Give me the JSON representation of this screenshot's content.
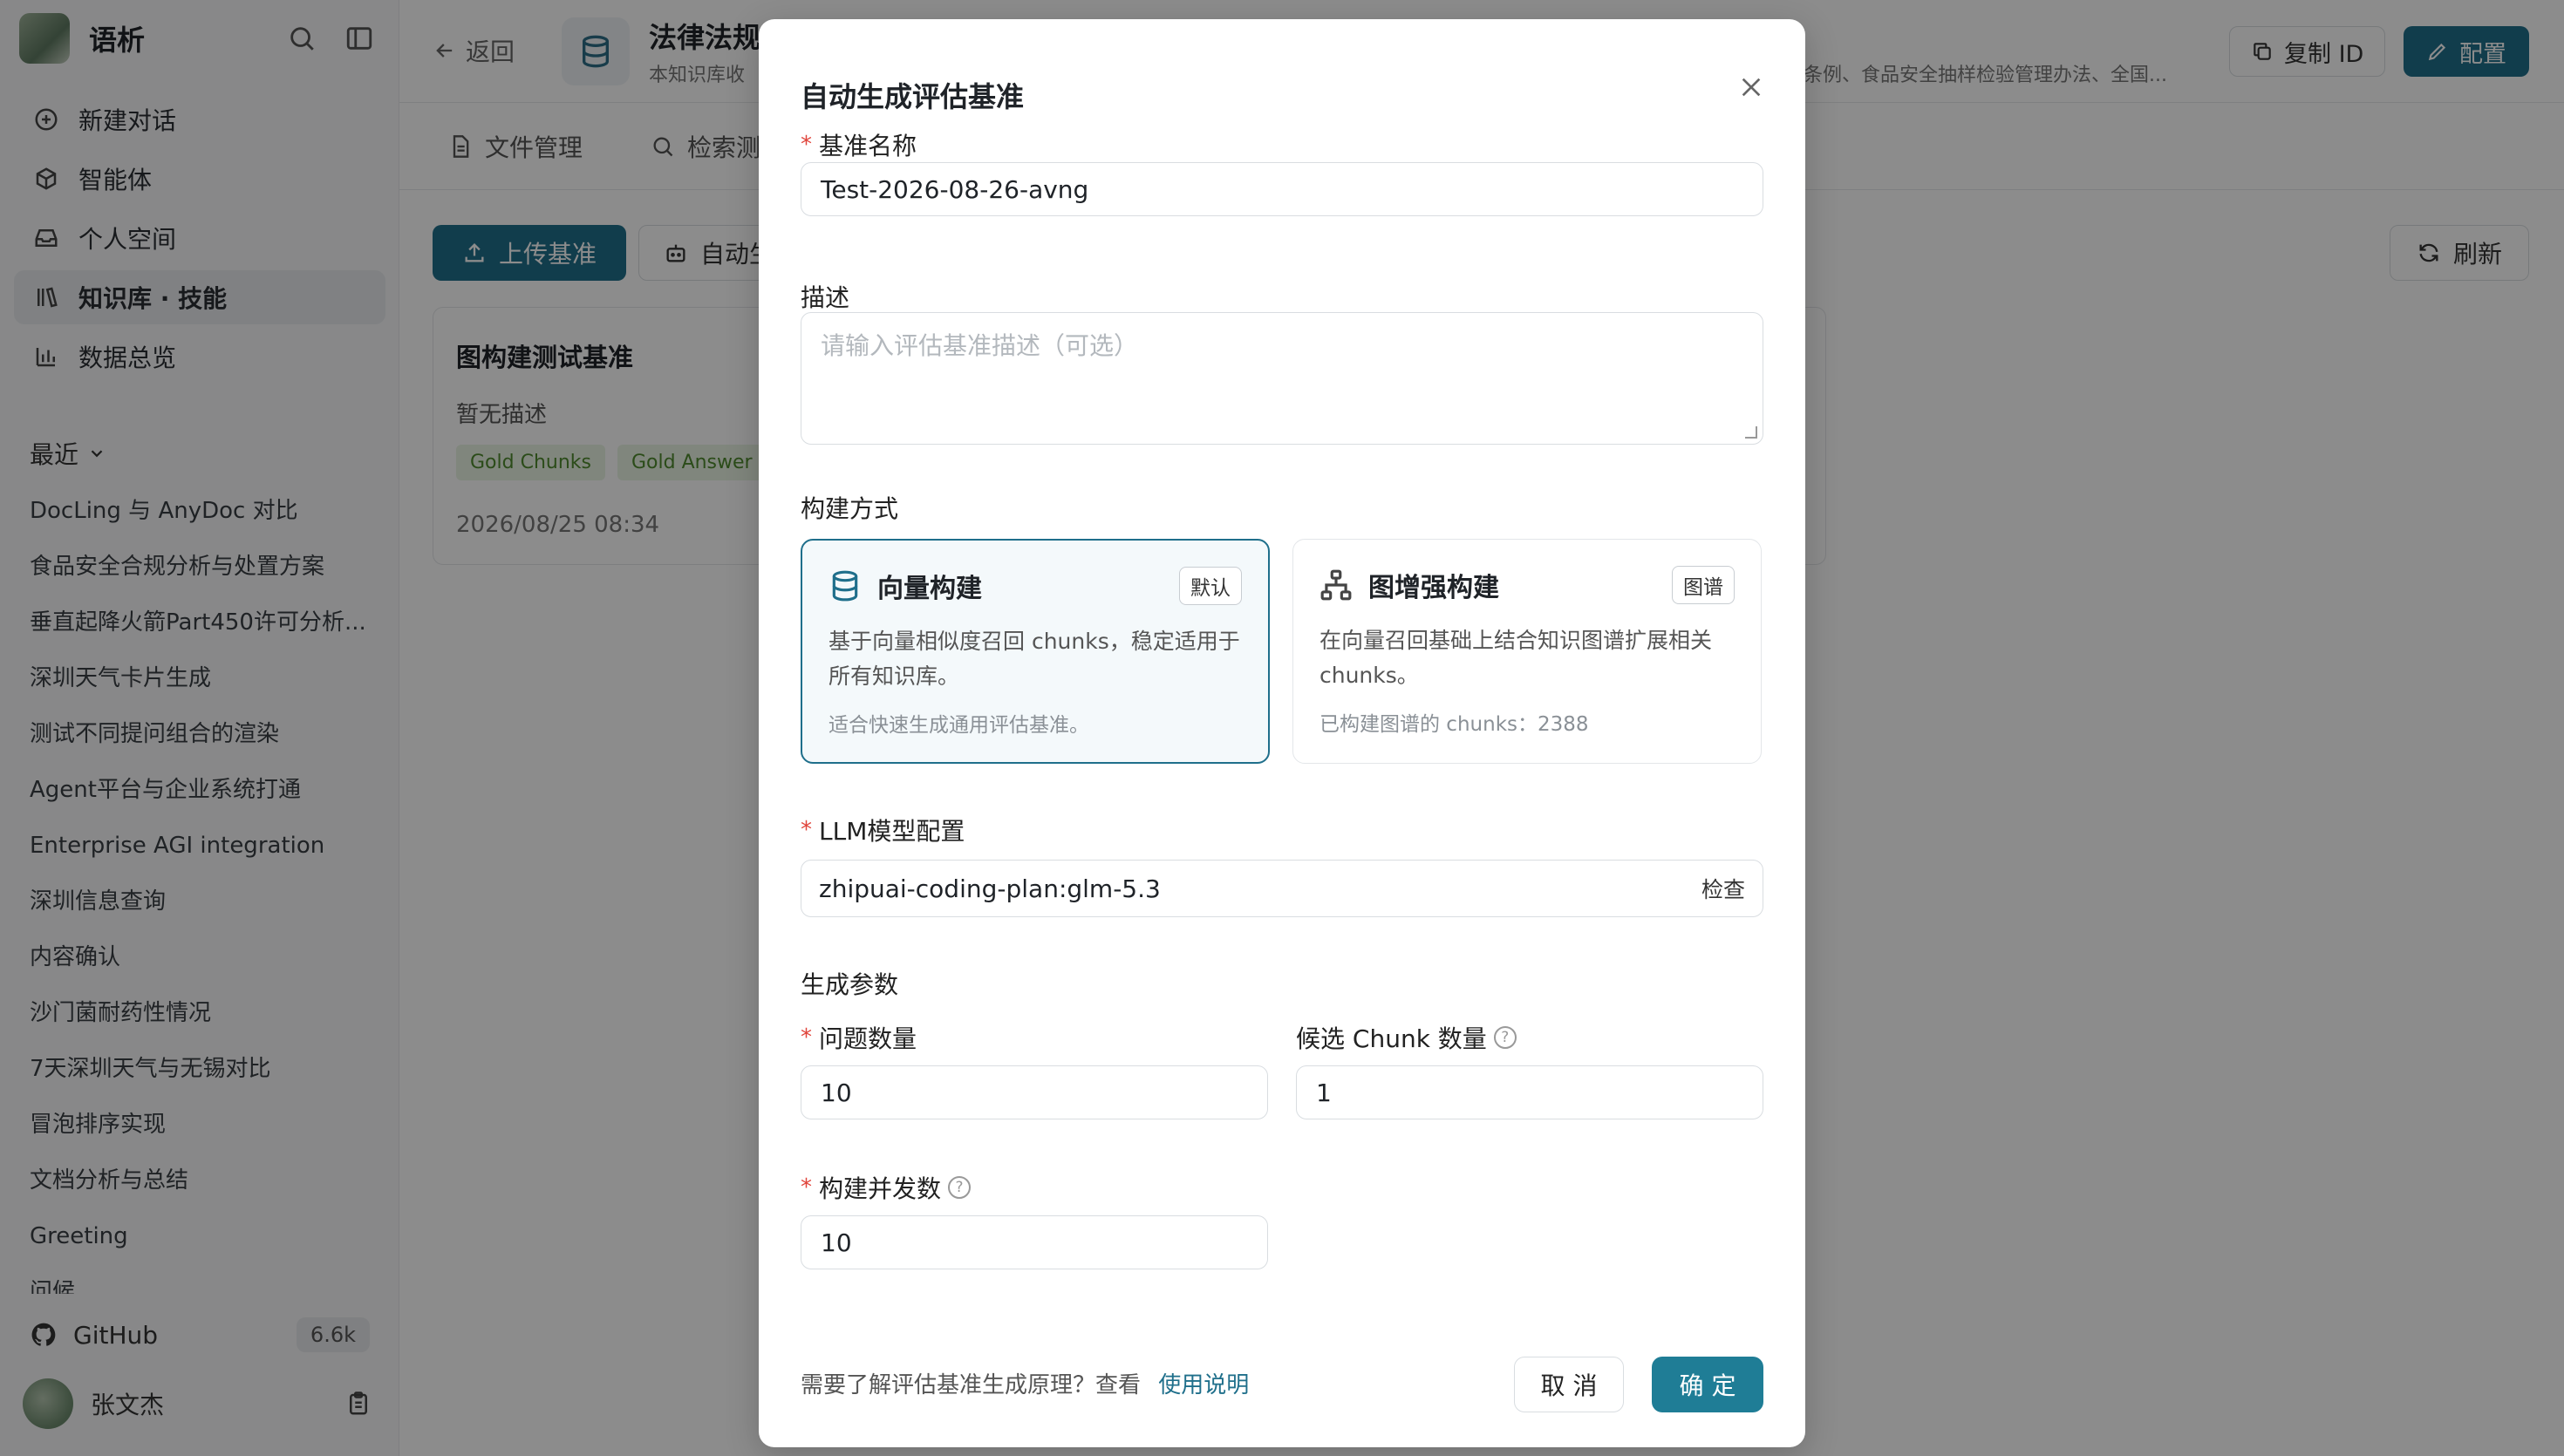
{
  "app": {
    "name": "语析"
  },
  "sidebar": {
    "nav": [
      {
        "label": "新建对话",
        "icon": "plus-circle-icon"
      },
      {
        "label": "智能体",
        "icon": "cube-icon"
      },
      {
        "label": "个人空间",
        "icon": "inbox-icon"
      },
      {
        "label": "知识库 · 技能",
        "icon": "library-icon",
        "active": true
      },
      {
        "label": "数据总览",
        "icon": "bar-chart-icon"
      }
    ],
    "recent_label": "最近",
    "recent": [
      "DocLing 与 AnyDoc 对比",
      "食品安全合规分析与处置方案",
      "垂直起降火箭Part450许可分析...",
      "深圳天气卡片生成",
      "测试不同提问组合的渲染",
      "Agent平台与企业系统打通",
      "Enterprise AGI integration",
      "深圳信息查询",
      "内容确认",
      "沙门菌耐药性情况",
      "7天深圳天气与无锡对比",
      "冒泡排序实现",
      "文档分析与总结",
      "Greeting",
      "问候"
    ],
    "github": {
      "label": "GitHub",
      "stars": "6.6k"
    },
    "user": {
      "name": "张文杰"
    }
  },
  "header": {
    "back_label": "返回",
    "kb_title": "法律法规",
    "kb_subtitle": "本知识库收",
    "kb_desc_tail": "条例、食品安全抽样检验管理办法、全国...",
    "copy_id_label": "复制 ID",
    "config_label": "配置"
  },
  "tabs": [
    {
      "label": "文件管理"
    },
    {
      "label": "检索测"
    }
  ],
  "toolbar": {
    "upload_label": "上传基准",
    "auto_label": "自动生",
    "refresh_label": "刷新"
  },
  "benchmark": {
    "title": "图构建测试基准",
    "desc": "暂无描述",
    "tags": [
      "Gold Chunks",
      "Gold Answer"
    ],
    "date": "2026/08/25 08:34"
  },
  "modal": {
    "title": "自动生成评估基准",
    "name_label": "基准名称",
    "name_value": "Test-2026-08-26-avng",
    "desc_label": "描述",
    "desc_placeholder": "请输入评估基准描述（可选）",
    "method_label": "构建方式",
    "methods": [
      {
        "title": "向量构建",
        "badge": "默认",
        "desc": "基于向量相似度召回 chunks，稳定适用于所有知识库。",
        "foot": "适合快速生成通用评估基准。"
      },
      {
        "title": "图增强构建",
        "badge": "图谱",
        "desc": "在向量召回基础上结合知识图谱扩展相关 chunks。",
        "foot": "已构建图谱的 chunks：2388"
      }
    ],
    "llm_label": "LLM模型配置",
    "llm_value": "zhipuai-coding-plan:glm-5.3",
    "llm_check": "检查",
    "params_label": "生成参数",
    "question_count_label": "问题数量",
    "question_count_value": "10",
    "candidate_label": "候选 Chunk 数量",
    "candidate_value": "1",
    "concurrency_label": "构建并发数",
    "concurrency_value": "10",
    "footer_text": "需要了解评估基准生成原理？查看",
    "footer_link": "使用说明",
    "cancel_label": "取 消",
    "ok_label": "确 定"
  },
  "colors": {
    "primary": "#1f6f8b",
    "required": "#e0443b",
    "tag_bg": "#eaf4e4",
    "tag_text": "#4f8a2f"
  }
}
